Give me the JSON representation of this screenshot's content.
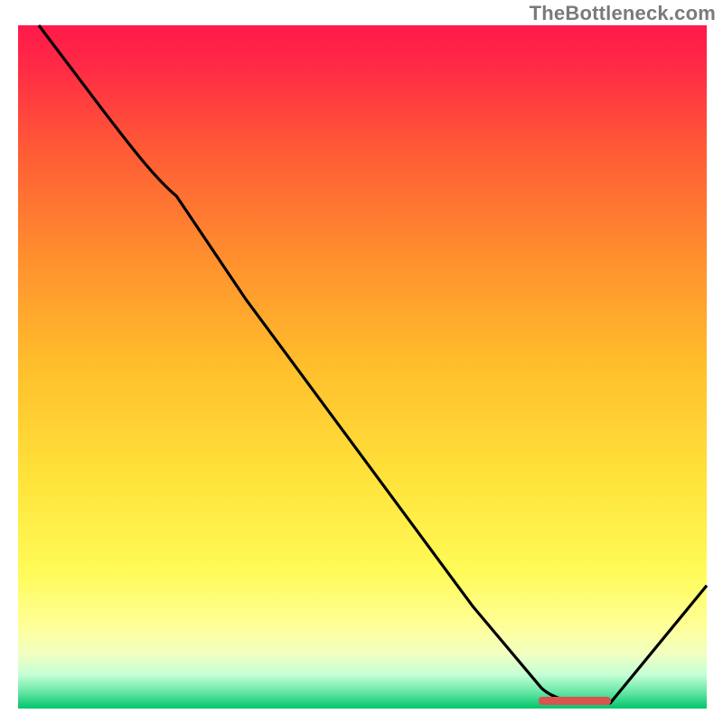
{
  "attribution": "TheBottleneck.com",
  "chart_data": {
    "type": "line",
    "title": "",
    "xlabel": "",
    "ylabel": "",
    "xlim": [
      0,
      100
    ],
    "ylim": [
      0,
      100
    ],
    "axes_visible": false,
    "grid": false,
    "background_gradient_stops": [
      {
        "pos": 0.0,
        "color": "#ff1a4b"
      },
      {
        "pos": 0.2,
        "color": "#ff5736"
      },
      {
        "pos": 0.45,
        "color": "#ffad29"
      },
      {
        "pos": 0.7,
        "color": "#ffe震3c"
      },
      {
        "pos": 0.84,
        "color": "#ffff66"
      },
      {
        "pos": 0.92,
        "color": "#f3ffb0"
      },
      {
        "pos": 0.955,
        "color": "#b7ffd4"
      },
      {
        "pos": 0.98,
        "color": "#2cd98a"
      },
      {
        "pos": 1.0,
        "color": "#00c46a"
      }
    ],
    "series": [
      {
        "name": "bottleneck-curve",
        "color": "#000000",
        "x": [
          3,
          12,
          23,
          33,
          44,
          55,
          66,
          76,
          82,
          86,
          100
        ],
        "values": [
          100,
          88,
          75,
          60,
          45,
          30,
          15,
          3,
          0.5,
          0.8,
          18
        ]
      }
    ],
    "marker": {
      "name": "optimal-range",
      "color": "#d9534f",
      "x_range": [
        76,
        86
      ],
      "y": 0.8,
      "thickness": 1.5
    }
  }
}
